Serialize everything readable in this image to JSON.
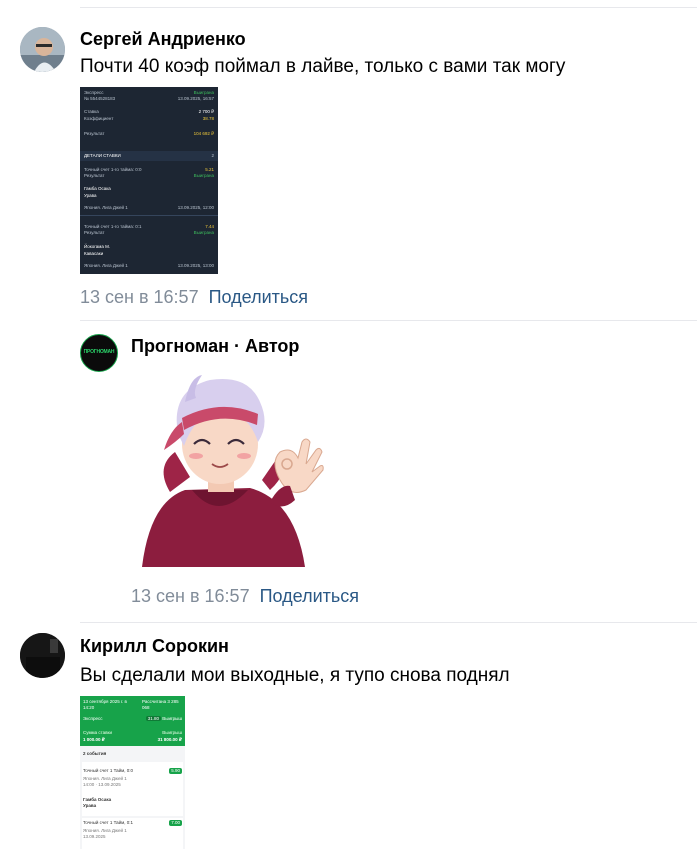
{
  "comments": [
    {
      "author": "Сергей Андриенко",
      "text": "Почти 40 коэф поймал в лайве, только с вами так могу",
      "date": "13 сен в 16:57",
      "share_label": "Поделиться",
      "attachment": {
        "header_left": "Экспресс",
        "header_id": "№ 5544528183",
        "header_right": "Выиграна",
        "header_date": "13.09.2025, 16:57",
        "stake_label": "Ставка",
        "stake_value": "2 700 ₽",
        "coef_label": "Коэффициент",
        "coef_value": "38.78",
        "result_label": "Результат",
        "result_value": "104 692 ₽",
        "details_label": "ДЕТАЛИ СТАВКИ",
        "details_count": "2",
        "events": [
          {
            "market": "Точный счет 1-го тайма: 0:0",
            "odds": "5.21",
            "result_label": "Результат",
            "status": "Выиграна",
            "team1": "Гамба Осака",
            "team2": "Урава",
            "league": "Япония. Лига Джей 1",
            "date": "13.09.2025, 12:00"
          },
          {
            "market": "Точный счет 1-го тайма: 0:1",
            "odds": "7.44",
            "result_label": "Результат",
            "status": "Выиграна",
            "team1": "Йокогама М.",
            "team2": "Кавасаки",
            "league": "Япония. Лига Джей 1",
            "date": "13.09.2025, 13:00"
          }
        ]
      }
    },
    {
      "author": "Прогноман · Автор",
      "avatar_text": "ПРОГНОМАН",
      "date": "13 сен в 16:57",
      "share_label": "Поделиться"
    },
    {
      "author": "Кирилл Сорокин",
      "text": "Вы сделали мои выходные, я тупо снова поднял",
      "attachment": {
        "top_date": "13 сентября 2025 г. в 14:20",
        "top_status": "Рассчитана 3 285 068",
        "type_label": "Экспресс",
        "coef_value": "31.80",
        "coef_status": "Выигрыш",
        "stake_label": "Сумма ставки",
        "stake_value": "1 000.00 ₽",
        "win_label": "Выигрыш",
        "win_value": "31 800.00 ₽",
        "events_label": "2 события",
        "events": [
          {
            "market": "Точный счет 1 Тайм, 0:0",
            "odds": "5.90",
            "league": "Япония. Лига Джей 1",
            "time": "14:00 · 13.09.2025",
            "team1": "Гамба Осака",
            "team2": "Урава"
          },
          {
            "market": "Точный счет 1 Тайм, 0:1",
            "odds": "7.00",
            "league": "Япония. Лига Джей 1",
            "time": "13.09.2025"
          }
        ]
      }
    }
  ],
  "colors": {
    "link": "#2a5885",
    "meta": "#818c99",
    "divider": "#e7e8ec",
    "dark_slip_bg": "#1d2633",
    "green_slip": "#17a34a"
  }
}
